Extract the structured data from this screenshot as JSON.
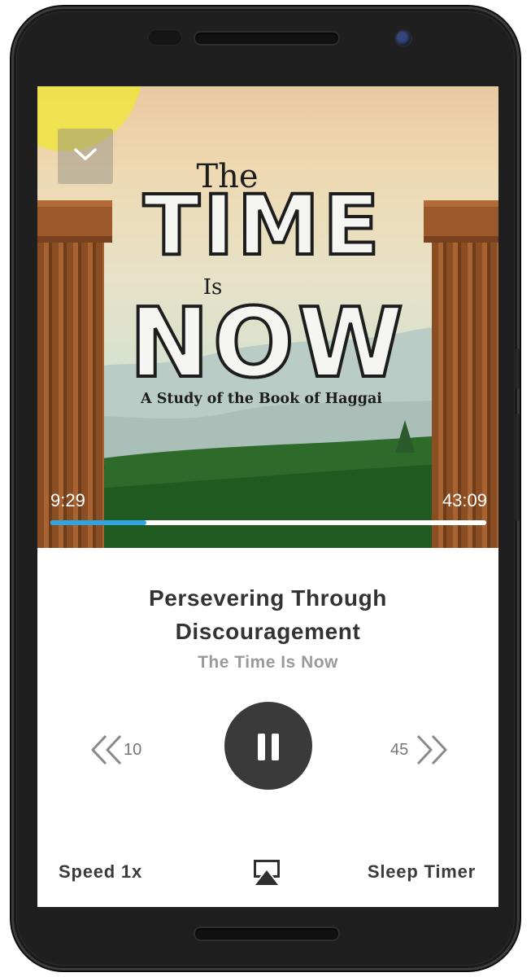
{
  "artwork": {
    "title_the": "The",
    "title_time": "TIME",
    "title_is": "Is",
    "title_now": "NOW",
    "subtitle": "A Study of the Book of Haggai",
    "collapse_icon": "chevron-down-icon"
  },
  "progress": {
    "elapsed": "9:29",
    "total": "43:09",
    "fraction": 0.22
  },
  "now_playing": {
    "title_line1": "Persevering Through",
    "title_line2": "Discouragement",
    "series": "The Time Is Now"
  },
  "controls": {
    "rewind_seconds": "10",
    "forward_seconds": "45",
    "rewind_icon": "rewind-icon",
    "forward_icon": "fast-forward-icon",
    "pause_icon": "pause-icon"
  },
  "footer": {
    "speed_label": "Speed 1x",
    "sleep_label": "Sleep Timer",
    "airplay_icon": "airplay-icon"
  },
  "colors": {
    "accent": "#2ea4e1",
    "title_text": "#333333",
    "subtitle_text": "#9a9a9a",
    "pause_button": "#3a3a3a"
  }
}
